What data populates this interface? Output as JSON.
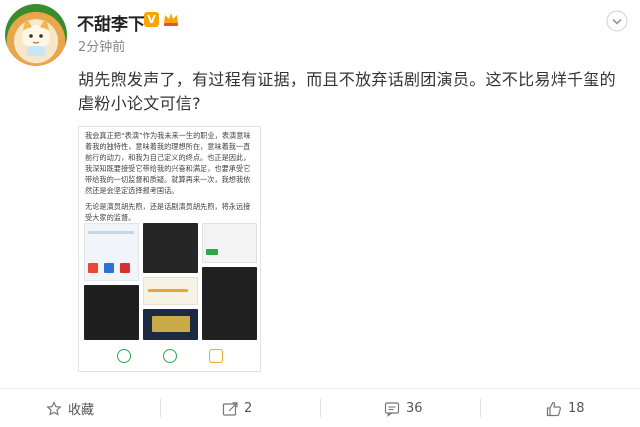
{
  "post": {
    "username": "不甜李下",
    "verified_badge": "V",
    "time": "2分钟前",
    "text": "胡先煦发声了，有过程有证据，而且不放弃话剧团演员。这不比易烊千玺的虐粉小论文可信?",
    "image": {
      "paragraph1": "我会真正把“表演”作为我未来一生的职业，表演意味着我的独特性，意味着我的理想所在，意味着我一直前行的动力，和我为自己定义的终点。也正是因此，我深知既要接受它带给我的兴奋和满足，也要承受它带给我的一切监督和质疑。就算再来一次，我想我依然还是会坚定选择报考国话。",
      "paragraph2": "无论是演员胡先煦，还是话剧演员胡先煦，将永远接受大家的监督。"
    }
  },
  "actions": {
    "favorite_label": "收藏",
    "repost_count": "2",
    "comment_count": "36",
    "like_count": "18"
  },
  "colors": {
    "accent_orange": "#f7a600",
    "text": "#333333",
    "muted": "#888888"
  }
}
